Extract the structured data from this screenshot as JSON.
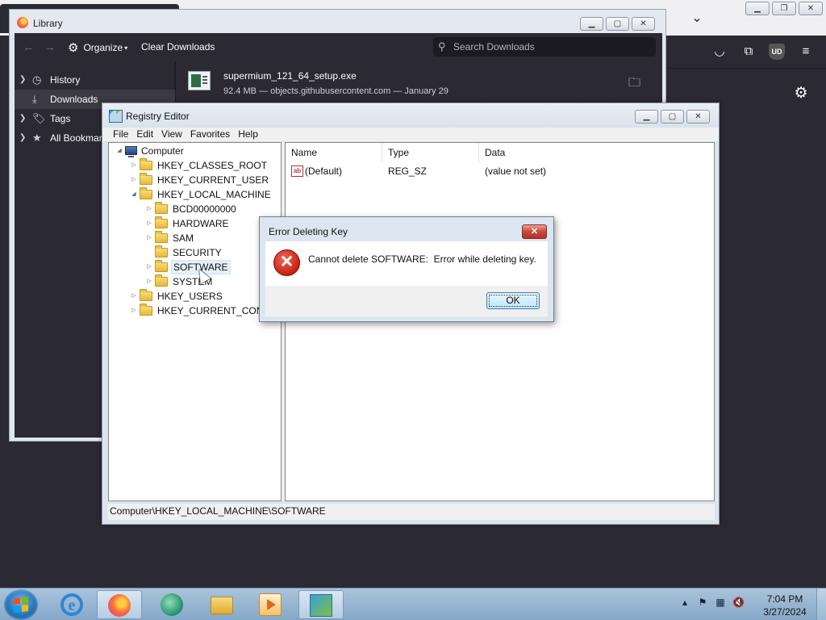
{
  "firefox": {
    "toolbar_icons": [
      "pocket-icon",
      "extensions-icon",
      "ublock-icon",
      "menu-icon"
    ],
    "ublock_badge": "UD"
  },
  "library": {
    "title": "Library",
    "organize_label": "Organize",
    "clear_label": "Clear Downloads",
    "search_placeholder": "Search Downloads",
    "sidebar": [
      {
        "label": "History",
        "icon": "clock-icon"
      },
      {
        "label": "Downloads",
        "icon": "download-icon"
      },
      {
        "label": "Tags",
        "icon": "tag-icon"
      },
      {
        "label": "All Bookmarks",
        "icon": "star-icon"
      }
    ],
    "download": {
      "filename": "supermium_121_64_setup.exe",
      "meta": "92.4 MB — objects.githubusercontent.com — January 29"
    }
  },
  "regedit": {
    "title": "Registry Editor",
    "menu": [
      "File",
      "Edit",
      "View",
      "Favorites",
      "Help"
    ],
    "tree": {
      "root": "Computer",
      "hives": [
        "HKEY_CLASSES_ROOT",
        "HKEY_CURRENT_USER",
        "HKEY_LOCAL_MACHINE",
        "HKEY_USERS",
        "HKEY_CURRENT_CONFIG"
      ],
      "hklm_children": [
        "BCD00000000",
        "HARDWARE",
        "SAM",
        "SECURITY",
        "SOFTWARE",
        "SYSTEM"
      ]
    },
    "columns": [
      "Name",
      "Type",
      "Data"
    ],
    "rows": [
      {
        "name": "(Default)",
        "type": "REG_SZ",
        "data": "(value not set)"
      }
    ],
    "status": "Computer\\HKEY_LOCAL_MACHINE\\SOFTWARE"
  },
  "dialog": {
    "title": "Error Deleting Key",
    "message": "Cannot delete SOFTWARE:  Error while deleting key.",
    "ok_label": "OK"
  },
  "taskbar": {
    "apps": [
      "Internet Explorer",
      "Firefox",
      "Chat",
      "File Explorer",
      "Media Player",
      "Registry Editor"
    ],
    "time": "7:04 PM",
    "date": "3/27/2024"
  }
}
